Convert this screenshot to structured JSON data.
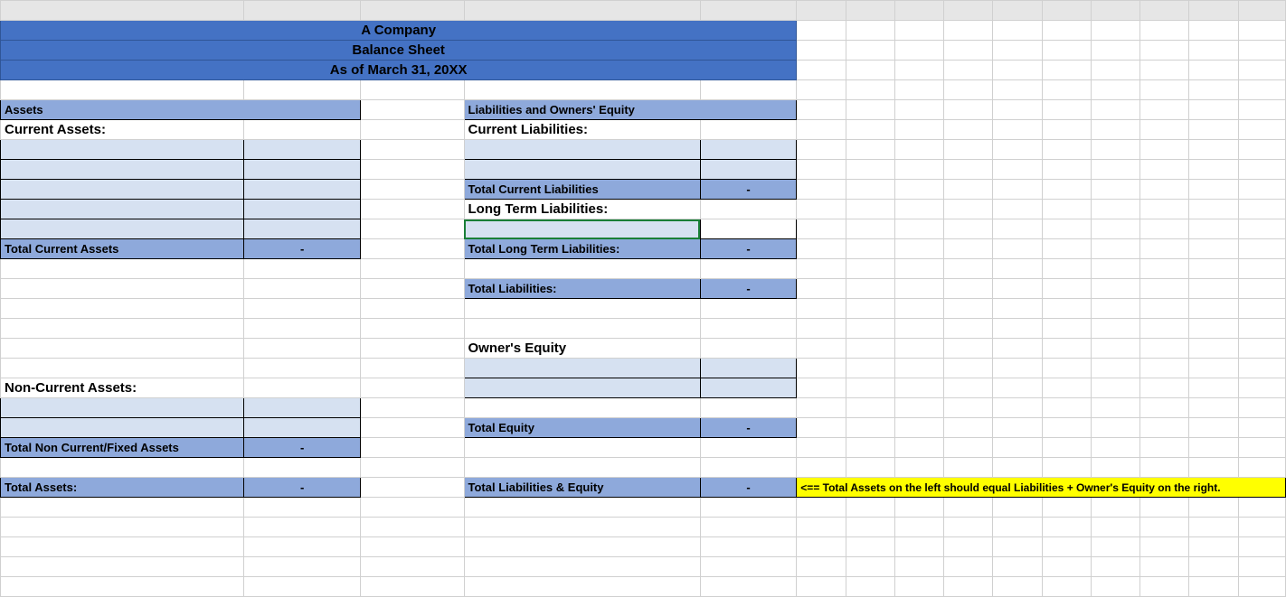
{
  "header": {
    "company": "A Company",
    "title": "Balance Sheet",
    "asof": "As of March 31, 20XX"
  },
  "left": {
    "assets_header": "Assets",
    "current_assets_label": "Current Assets:",
    "total_current_assets_label": "Total Current Assets",
    "total_current_assets_value": "-",
    "non_current_assets_label": "Non-Current Assets:",
    "total_non_current_label": "Total Non Current/Fixed Assets",
    "total_non_current_value": "-",
    "total_assets_label": "Total Assets:",
    "total_assets_value": "-"
  },
  "right": {
    "liab_equity_header": "Liabilities and Owners' Equity",
    "current_liab_label": "Current Liabilities:",
    "total_current_liab_label": "Total Current Liabilities",
    "total_current_liab_value": "-",
    "long_term_liab_label": "Long Term Liabilities:",
    "total_long_term_liab_label": "Total Long Term Liabilities:",
    "total_long_term_liab_value": "-",
    "total_liab_label": "Total Liabilities:",
    "total_liab_value": "-",
    "owners_equity_label": "Owner's Equity",
    "total_equity_label": "Total Equity",
    "total_equity_value": "-",
    "total_liab_equity_label": "Total Liabilities & Equity",
    "total_liab_equity_value": "-"
  },
  "note": "<== Total Assets on the left should equal Liabilities + Owner's Equity on the right."
}
